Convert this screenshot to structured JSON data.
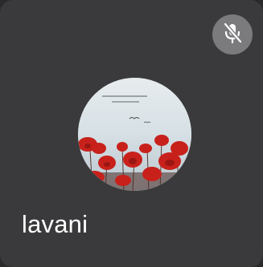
{
  "participant": {
    "name": "lavani",
    "microphone_status": "muted",
    "mute_icon": "microphone-off-icon",
    "avatar_icon": "red-flowers-profile-picture"
  },
  "colors": {
    "tile_background": "#3a3a3c",
    "page_background": "#2a2a2c",
    "mute_badge": "#7b7b7e",
    "name_text": "#ffffff",
    "flower_red": "#c8211b"
  }
}
